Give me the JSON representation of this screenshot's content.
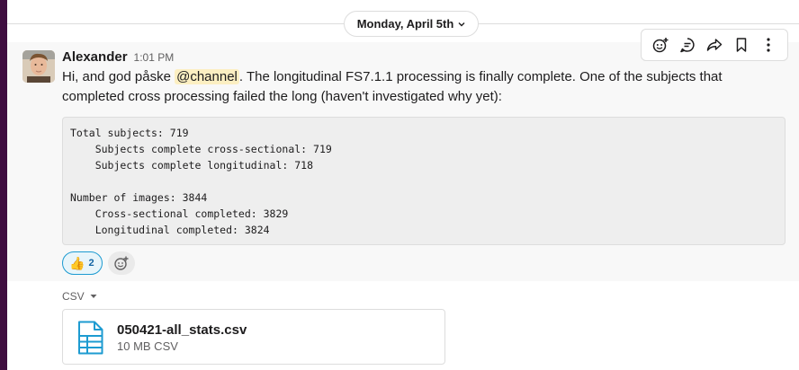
{
  "day_divider": {
    "label": "Monday, April 5th"
  },
  "message": {
    "author": "Alexander",
    "time": "1:01 PM",
    "text_before": "Hi, and god påske ",
    "mention": "@channel",
    "text_after": ". The longitudinal FS7.1.1 processing is finally complete. One of the subjects that completed cross processing failed the long (haven't investigated why yet):",
    "code_lines": [
      "Total subjects: 719",
      "    Subjects complete cross-sectional: 719",
      "    Subjects complete longitudinal: 718",
      "",
      "Number of images: 3844",
      "    Cross-sectional completed: 3829",
      "    Longitudinal completed: 3824"
    ],
    "reaction": {
      "emoji": "👍",
      "count": "2"
    }
  },
  "toolbar": {
    "icons": [
      "add-reaction-icon",
      "reply-in-thread-icon",
      "share-icon",
      "bookmark-icon",
      "more-actions-icon"
    ]
  },
  "attachment": {
    "type_label": "CSV",
    "file_name": "050421-all_stats.csv",
    "file_meta": "10 MB CSV"
  },
  "colors": {
    "accent_blue": "#1264a3",
    "mention_bg": "#fcefc2",
    "sidebar": "#3f0e40",
    "file_icon": "#1d9bd1"
  }
}
